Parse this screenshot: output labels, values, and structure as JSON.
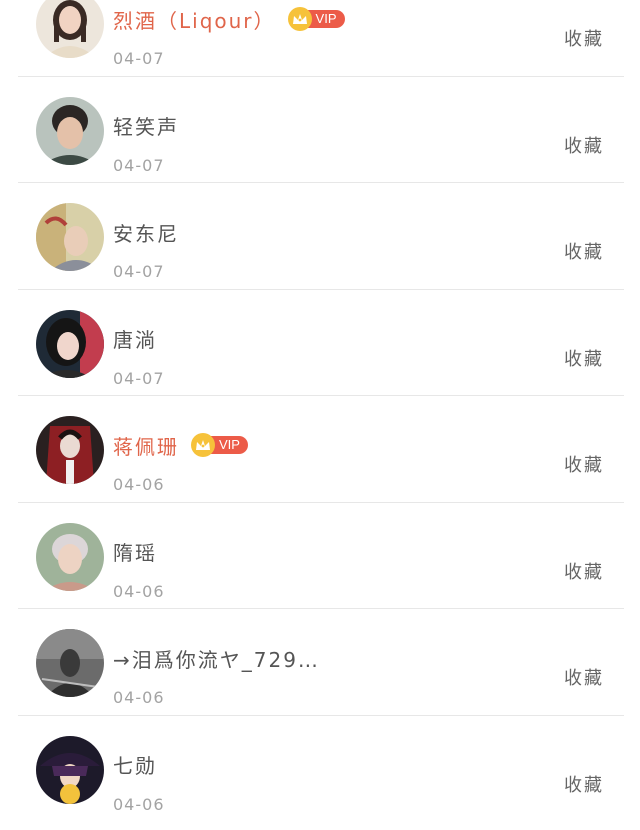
{
  "favorite_label": "收藏",
  "vip_label": "VIP",
  "colors": {
    "vip_name": "#e0654a",
    "vip_tag": "#ec5b48",
    "vip_crown": "#f6c23a",
    "name": "#555555",
    "date": "#a3a3a3"
  },
  "users": [
    {
      "name": "烈酒（Liqour）",
      "date": "04-07",
      "vip": true
    },
    {
      "name": "轻笑声",
      "date": "04-07",
      "vip": false
    },
    {
      "name": "安东尼",
      "date": "04-07",
      "vip": false
    },
    {
      "name": "唐淌",
      "date": "04-07",
      "vip": false
    },
    {
      "name": "蒋佩珊",
      "date": "04-06",
      "vip": true
    },
    {
      "name": "隋瑶",
      "date": "04-06",
      "vip": false
    },
    {
      "name": "→泪爲你流ヤ_729…",
      "date": "04-06",
      "vip": false
    },
    {
      "name": "七勋",
      "date": "04-06",
      "vip": false
    }
  ]
}
